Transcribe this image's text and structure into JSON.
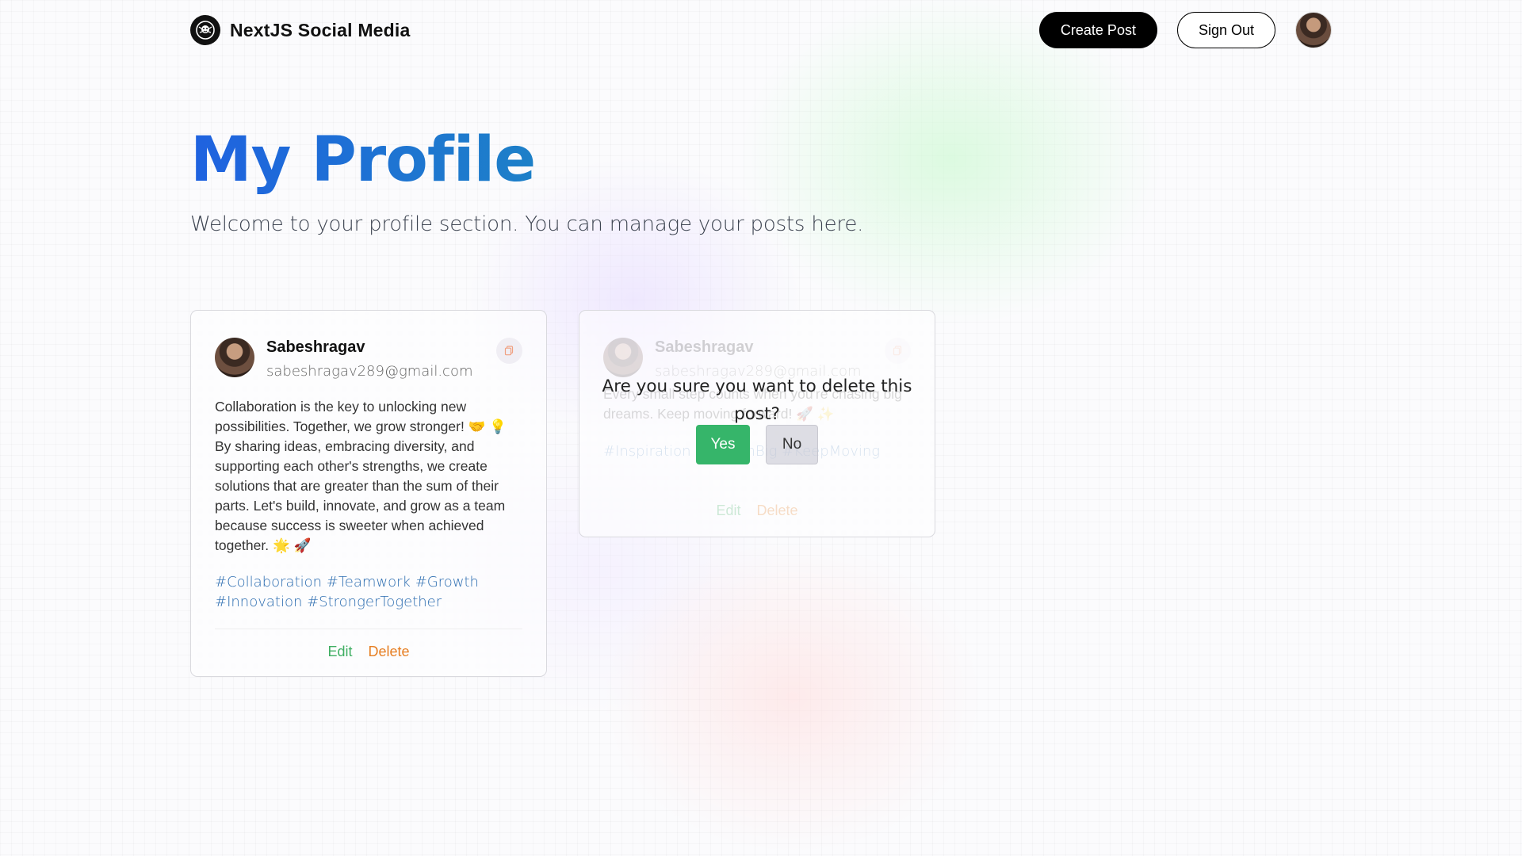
{
  "nav": {
    "brand": "NextJS Social Media",
    "create_post": "Create Post",
    "sign_out": "Sign Out"
  },
  "header": {
    "title": "My Profile",
    "subtitle": "Welcome to your profile section. You can manage your posts here."
  },
  "posts": [
    {
      "user": "Sabeshragav",
      "email": "sabeshragav289@gmail.com",
      "text": "Collaboration is the key to unlocking new possibilities. Together, we grow stronger! 🤝 💡 By sharing ideas, embracing diversity, and supporting each other's strengths, we create solutions that are greater than the sum of their parts. Let's build, innovate, and grow as a team because success is sweeter when achieved together. 🌟 🚀",
      "tags": "#Collaboration #Teamwork #Growth #Innovation #StrongerTogether",
      "edit": "Edit",
      "delete": "Delete"
    },
    {
      "user": "Sabeshragav",
      "email": "sabeshragav289@gmail.com",
      "text": "Every small step counts when you're chasing big dreams. Keep moving forward! 🚀 ✨",
      "tags": "#Inspiration #DreamBig #KeepMoving",
      "edit": "Edit",
      "delete": "Delete"
    }
  ],
  "confirm_dialog": {
    "question": "Are you sure you want to delete this post?",
    "yes": "Yes",
    "no": "No"
  },
  "colors": {
    "title_gradient_start": "#1f62e0",
    "title_gradient_end": "#1d80c8",
    "edit": "#3fae62",
    "delete": "#e67e22",
    "tag": "#2b6cb0",
    "yes_button": "#36b56a"
  },
  "icons": {
    "logo": "lion-logo-icon",
    "copy": "copy-icon"
  }
}
